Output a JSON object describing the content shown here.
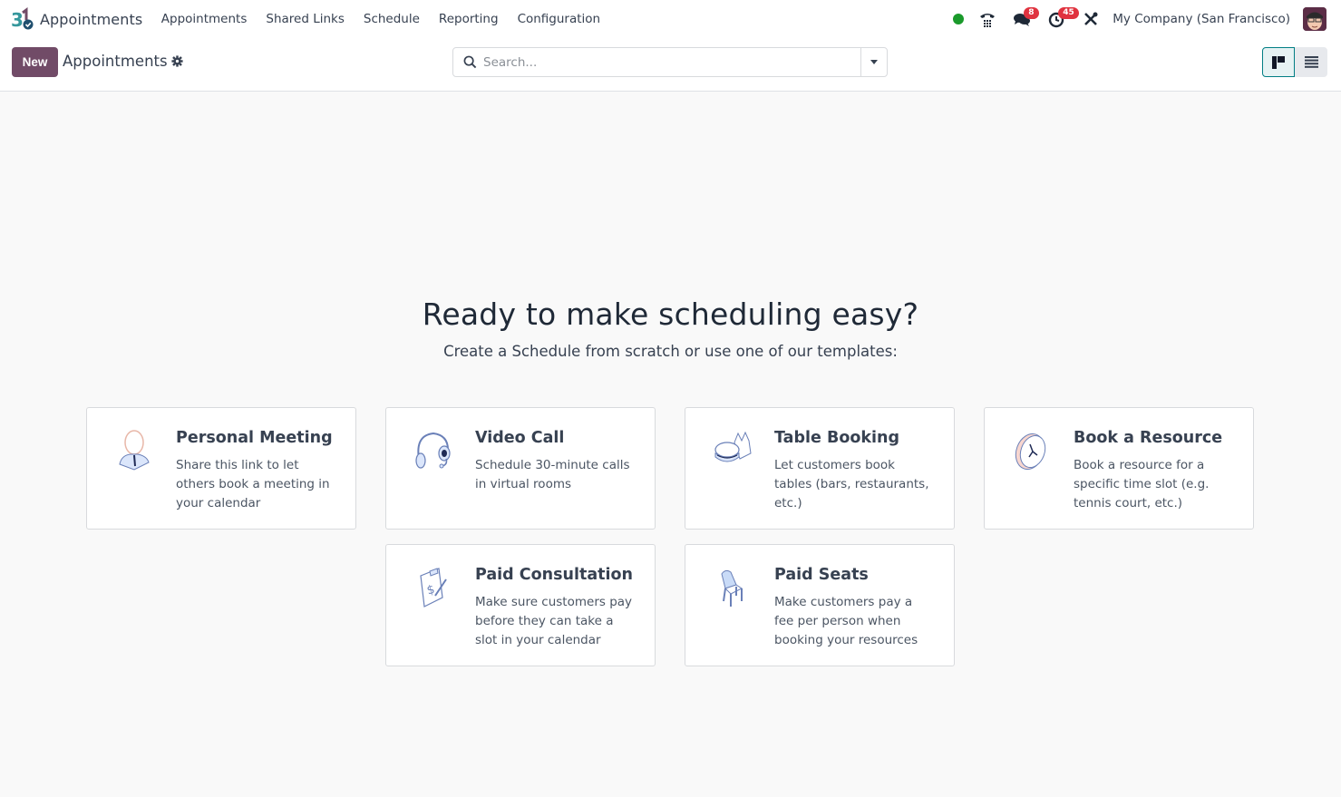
{
  "navbar": {
    "app_name": "Appointments",
    "menu": [
      {
        "label": "Appointments"
      },
      {
        "label": "Shared Links"
      },
      {
        "label": "Schedule"
      },
      {
        "label": "Reporting"
      },
      {
        "label": "Configuration"
      }
    ],
    "systray": {
      "presence_color": "#1a9a2b",
      "messages_count": "8",
      "activities_count": "45",
      "company": "My Company (San Francisco)"
    }
  },
  "control_panel": {
    "new_label": "New",
    "title": "Appointments",
    "search_placeholder": "Search...",
    "search_value": "",
    "views": [
      {
        "name": "kanban",
        "active": true
      },
      {
        "name": "list",
        "active": false
      }
    ]
  },
  "helper": {
    "title": "Ready to make scheduling easy?",
    "subtitle": "Create a Schedule from scratch or use one of our templates:",
    "templates": [
      {
        "icon": "person-icon",
        "title": "Personal Meeting",
        "description": "Share this link to let others book a meeting in your calendar"
      },
      {
        "icon": "headset-icon",
        "title": "Video Call",
        "description": "Schedule 30-minute calls in virtual rooms"
      },
      {
        "icon": "burger-fries-icon",
        "title": "Table Booking",
        "description": "Let customers book tables (bars, restaurants, etc.)"
      },
      {
        "icon": "clock-icon",
        "title": "Book a Resource",
        "description": "Book a resource for a specific time slot (e.g. tennis court, etc.)"
      },
      {
        "icon": "clipboard-dollar-icon",
        "title": "Paid Consultation",
        "description": "Make sure customers pay before they can take a slot in your calendar"
      },
      {
        "icon": "chair-icon",
        "title": "Paid Seats",
        "description": "Make customers pay a fee per person when booking your resources"
      }
    ]
  },
  "colors": {
    "brand": "#714b67",
    "accent": "#017e84",
    "badge": "#e0333f"
  }
}
